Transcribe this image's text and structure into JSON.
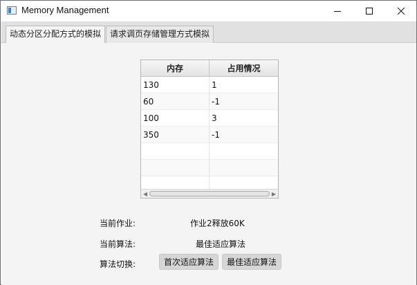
{
  "window": {
    "title": "Memory Management",
    "controls": [
      "minimize-icon",
      "maximize-icon",
      "close-icon"
    ]
  },
  "tabs": [
    {
      "label": "动态分区分配方式的模拟",
      "active": true
    },
    {
      "label": "请求调页存储管理方式模拟",
      "active": false
    }
  ],
  "table": {
    "columns": [
      "内存",
      "占用情况"
    ],
    "rows": [
      [
        "130",
        "1"
      ],
      [
        "60",
        "-1"
      ],
      [
        "100",
        "3"
      ],
      [
        "350",
        "-1"
      ],
      [
        "",
        ""
      ],
      [
        "",
        ""
      ],
      [
        "",
        ""
      ]
    ]
  },
  "status": {
    "current_job_label": "当前作业:",
    "current_job_value": "作业2释放60K",
    "current_algorithm_label": "当前算法:",
    "current_algorithm_value": "最佳适应算法",
    "switch_label": "算法切换:"
  },
  "buttons": {
    "first_fit": "首次适应算法",
    "best_fit": "最佳适应算法"
  }
}
